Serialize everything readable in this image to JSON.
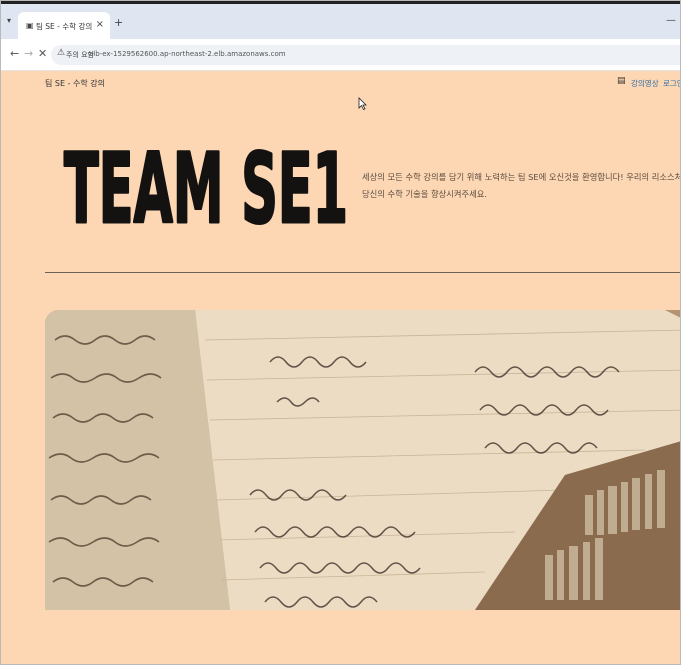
{
  "browser": {
    "tab_title": "팀 SE - 수학 강의",
    "tab_close": "×",
    "new_tab": "+",
    "address_security": "주의 요함",
    "url": "alb-ex-1529562600.ap-northeast-2.elb.amazonaws.com"
  },
  "header": {
    "site_title": "팀 SE - 수학 강의",
    "nav": [
      "강의영상",
      "로그인"
    ]
  },
  "hero": {
    "logo_text": "TEAM SE1",
    "intro_line1": "세상의 모든 수학 강의를 담기 위해 노력하는 팀 SE에 오신것을 환영합니다! 우리의 리소스처럼",
    "intro_line2": "당신의 수학 기술을 향상시켜주세요."
  },
  "colors": {
    "page_bg": "#fdd7b3",
    "link": "#2f6ea7",
    "divider": "#6e6258"
  }
}
